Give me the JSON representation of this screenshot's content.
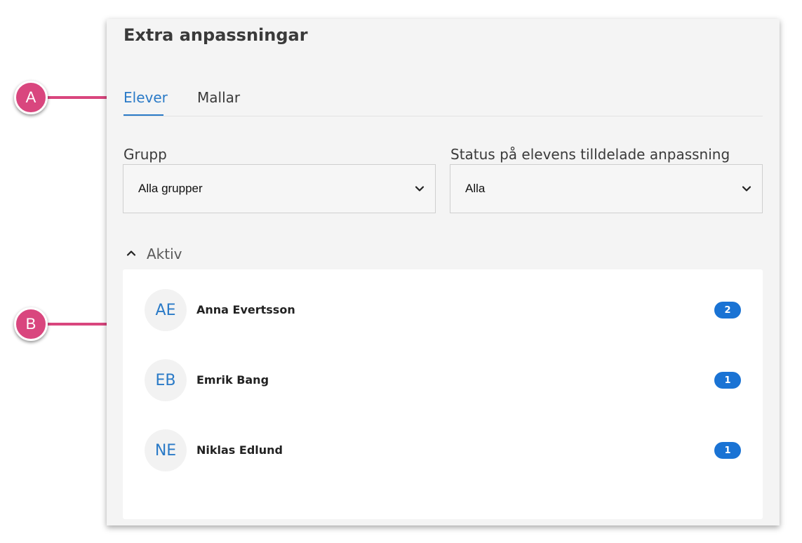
{
  "window": {
    "title": "Extra anpassningar"
  },
  "tabs": [
    {
      "label": "Elever",
      "active": true
    },
    {
      "label": "Mallar",
      "active": false
    }
  ],
  "filters": {
    "group": {
      "label": "Grupp",
      "value": "Alla grupper"
    },
    "status": {
      "label": "Status på elevens tilldelade anpassning",
      "value": "Alla"
    }
  },
  "section": {
    "label": "Aktiv",
    "expanded": true
  },
  "students": [
    {
      "initials": "AE",
      "name": "Anna Evertsson",
      "count": "2"
    },
    {
      "initials": "EB",
      "name": "Emrik Bang",
      "count": "1"
    },
    {
      "initials": "NE",
      "name": "Niklas Edlund",
      "count": "1"
    }
  ],
  "callouts": {
    "a": "A",
    "b": "B"
  },
  "colors": {
    "accent": "#2a7ac7",
    "badge": "#1a73d4",
    "callout": "#d9467e",
    "panel": "#f4f4f4"
  }
}
